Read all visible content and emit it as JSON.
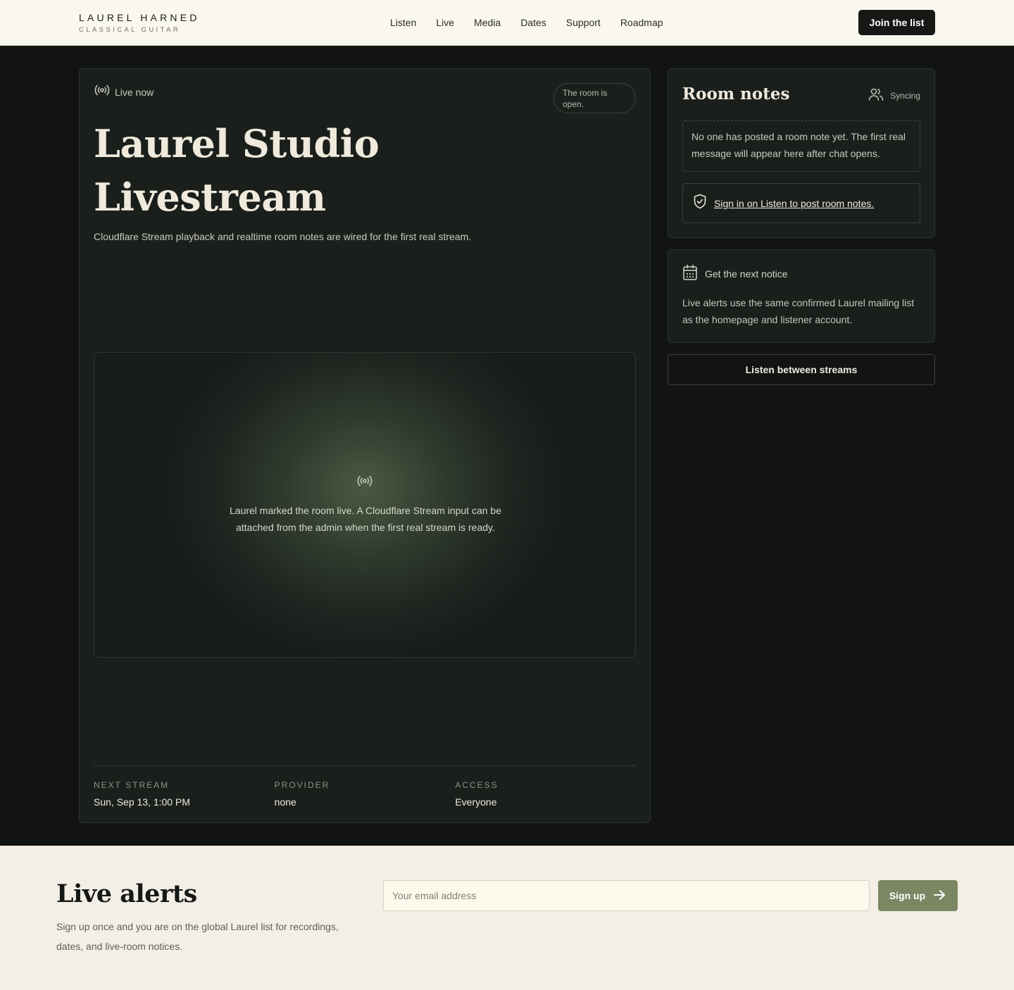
{
  "header": {
    "brand_name": "LAUREL HARNED",
    "brand_sub": "CLASSICAL GUITAR",
    "nav": [
      {
        "label": "Listen"
      },
      {
        "label": "Live"
      },
      {
        "label": "Media"
      },
      {
        "label": "Dates"
      },
      {
        "label": "Support"
      },
      {
        "label": "Roadmap"
      }
    ],
    "join_label": "Join the list"
  },
  "stream": {
    "live_label": "Live now",
    "room_status": "The room is open.",
    "title": "Laurel Studio Livestream",
    "description": "Cloudflare Stream playback and realtime room notes are wired for the first real stream.",
    "player_message": "Laurel marked the room live. A Cloudflare Stream input can be attached from the admin when the first real stream is ready.",
    "meta": [
      {
        "label": "NEXT STREAM",
        "value": "Sun, Sep 13, 1:00 PM"
      },
      {
        "label": "PROVIDER",
        "value": "none"
      },
      {
        "label": "ACCESS",
        "value": "Everyone"
      }
    ]
  },
  "room_notes": {
    "title": "Room notes",
    "sync_label": "Syncing",
    "empty_text": "No one has posted a room note yet. The first real message will appear here after chat opens.",
    "signin_link": "Sign in on Listen to post room notes."
  },
  "notice": {
    "title": "Get the next notice",
    "body": "Live alerts use the same confirmed Laurel mailing list as the homepage and listener account."
  },
  "between_label": "Listen between streams",
  "alerts": {
    "title": "Live alerts",
    "description": "Sign up once and you are on the global Laurel list for recordings, dates, and live-room notices.",
    "email_placeholder": "Your email address",
    "signup_label": "Sign up"
  },
  "colors": {
    "dark_bg": "#121411",
    "card_bg": "#1b1f1c",
    "accent_green": "#7a8762",
    "cream": "#f9f7ee"
  },
  "icons": [
    "broadcast-icon",
    "users-icon",
    "shield-check-icon",
    "calendar-icon",
    "arrow-right-icon"
  ]
}
